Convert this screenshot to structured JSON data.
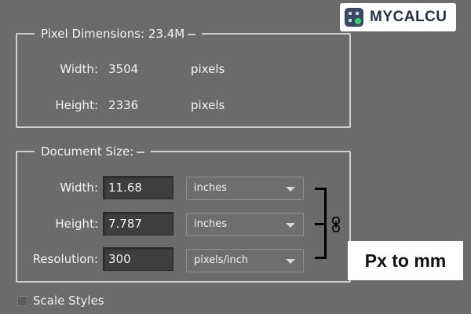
{
  "pixel_dimensions": {
    "title": "Pixel Dimensions:",
    "size": "23.4M",
    "width_label": "Width:",
    "width_value": "3504",
    "width_unit": "pixels",
    "height_label": "Height:",
    "height_value": "2336",
    "height_unit": "pixels"
  },
  "document_size": {
    "title": "Document Size:",
    "width_label": "Width:",
    "width_value": "11.68",
    "width_unit": "inches",
    "height_label": "Height:",
    "height_value": "7.787",
    "height_unit": "inches",
    "resolution_label": "Resolution:",
    "resolution_value": "300",
    "resolution_unit": "pixels/inch"
  },
  "scale_styles": {
    "label": "Scale Styles",
    "checked": false
  },
  "brand": {
    "name": "MYCALCU"
  },
  "caption": "Px to mm",
  "icons": [
    "calculator-icon",
    "chevron-down-icon",
    "chain-link-icon",
    "checkbox-icon"
  ],
  "colors": {
    "panel_bg": "#6b6b6b",
    "field_bg": "#3e3e3e",
    "brand_dark": "#253044",
    "brand_accent": "#3ccf7a"
  }
}
